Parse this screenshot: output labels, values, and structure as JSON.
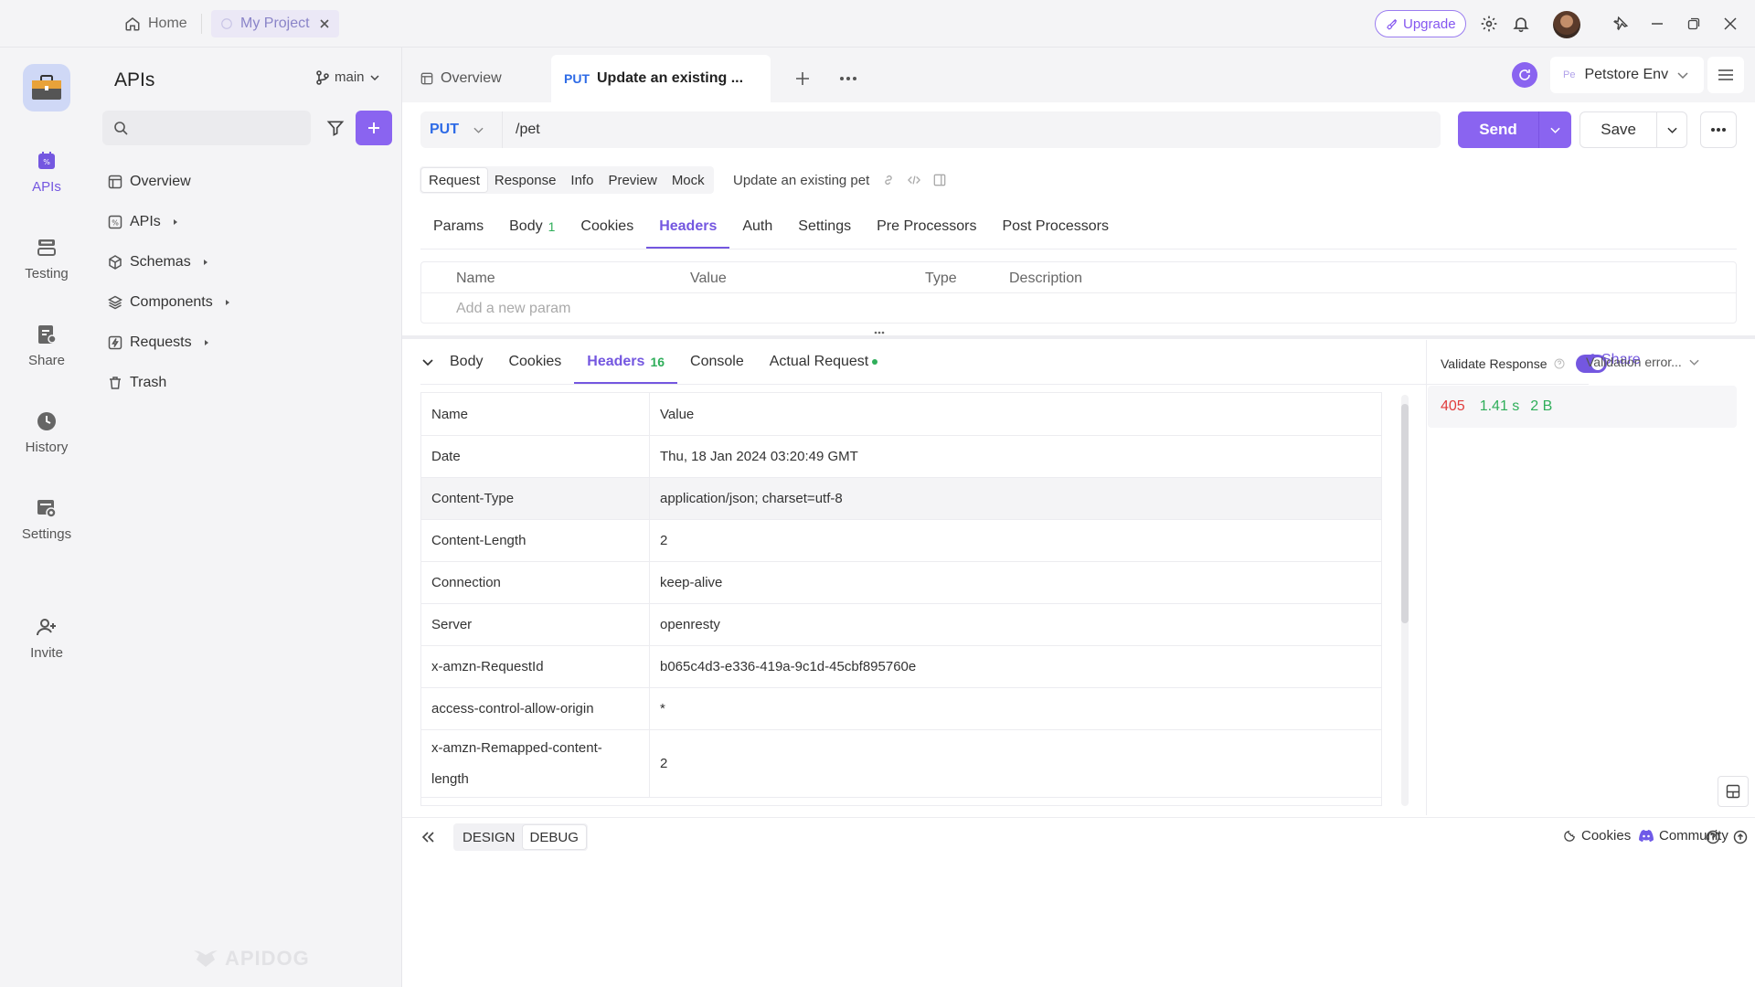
{
  "titlebar": {
    "home_label": "Home",
    "project_tab": "My Project",
    "upgrade_label": "Upgrade"
  },
  "rail": {
    "items": [
      {
        "label": "APIs",
        "icon": "apis-icon"
      },
      {
        "label": "Testing",
        "icon": "testing-icon"
      },
      {
        "label": "Share",
        "icon": "share-icon"
      },
      {
        "label": "History",
        "icon": "history-icon"
      },
      {
        "label": "Settings",
        "icon": "settings-icon"
      },
      {
        "label": "Invite",
        "icon": "invite-icon"
      }
    ]
  },
  "sidebar": {
    "title": "APIs",
    "branch": "main",
    "tree": [
      {
        "label": "Overview"
      },
      {
        "label": "APIs"
      },
      {
        "label": "Schemas"
      },
      {
        "label": "Components"
      },
      {
        "label": "Requests"
      },
      {
        "label": "Trash"
      }
    ],
    "watermark": "APIDOG"
  },
  "tabs": {
    "overview": "Overview",
    "active_method": "PUT",
    "active_title": "Update an existing ..."
  },
  "env": {
    "abbr": "Pe",
    "name": "Petstore Env"
  },
  "request": {
    "method": "PUT",
    "url": "/pet",
    "send_label": "Send",
    "save_label": "Save",
    "modes": [
      "Request",
      "Response",
      "Info",
      "Preview",
      "Mock"
    ],
    "api_name": "Update an existing pet",
    "subtabs": [
      {
        "label": "Params",
        "badge": ""
      },
      {
        "label": "Body",
        "badge": "1"
      },
      {
        "label": "Cookies",
        "badge": ""
      },
      {
        "label": "Headers",
        "badge": ""
      },
      {
        "label": "Auth",
        "badge": ""
      },
      {
        "label": "Settings",
        "badge": ""
      },
      {
        "label": "Pre Processors",
        "badge": ""
      },
      {
        "label": "Post Processors",
        "badge": ""
      }
    ],
    "params_columns": [
      "Name",
      "Value",
      "Type",
      "Description"
    ],
    "add_param_placeholder": "Add a new param"
  },
  "response": {
    "tabs": [
      {
        "label": "Body",
        "badge": ""
      },
      {
        "label": "Cookies",
        "badge": ""
      },
      {
        "label": "Headers",
        "badge": "16"
      },
      {
        "label": "Console",
        "badge": ""
      },
      {
        "label": "Actual Request",
        "badge": ""
      }
    ],
    "share_label": "Share",
    "columns": [
      "Name",
      "Value"
    ],
    "headers": [
      {
        "name": "Date",
        "value": "Thu, 18 Jan 2024 03:20:49 GMT"
      },
      {
        "name": "Content-Type",
        "value": "application/json; charset=utf-8"
      },
      {
        "name": "Content-Length",
        "value": "2"
      },
      {
        "name": "Connection",
        "value": "keep-alive"
      },
      {
        "name": "Server",
        "value": "openresty"
      },
      {
        "name": "x-amzn-RequestId",
        "value": "b065c4d3-e336-419a-9c1d-45cbf895760e"
      },
      {
        "name": "access-control-allow-origin",
        "value": "*"
      },
      {
        "name": "x-amzn-Remapped-content-length",
        "value": "2"
      }
    ]
  },
  "validation": {
    "label": "Validate Response",
    "dropdown": "Validation error...",
    "status_code": "405",
    "time": "1.41 s",
    "size": "2 B"
  },
  "footer": {
    "modes": [
      "DESIGN",
      "DEBUG"
    ],
    "cookies_label": "Cookies",
    "community_label": "Community"
  },
  "colors": {
    "accent": "#7457e0",
    "send": "#8a64f0",
    "method": "#2e6be6",
    "status_error": "#e03c3c",
    "status_ok": "#2fae5a"
  }
}
